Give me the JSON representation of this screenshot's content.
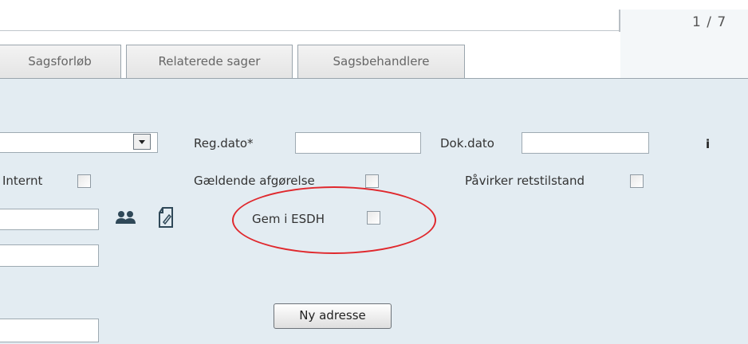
{
  "header": {
    "pager": "1 / 7"
  },
  "tabs": [
    {
      "label": "Sagsforløb"
    },
    {
      "label": "Relaterede sager"
    },
    {
      "label": "Sagsbehandlere"
    }
  ],
  "form": {
    "reg_dato_label": "Reg.dato*",
    "reg_dato_value": "",
    "dok_dato_label": "Dok.dato",
    "dok_dato_value": "",
    "info_glyph": "i",
    "internt_label": "Internt",
    "gaeldende_label": "Gældende afgørelse",
    "paavirker_label": "Påvirker retstilstand",
    "gem_label": "Gem i ESDH",
    "ny_adresse_label": "Ny adresse"
  },
  "icons": [
    "users-icon",
    "document-icon",
    "dropdown-arrow-icon",
    "info-icon"
  ],
  "colors": {
    "panel": "#e3ecf2",
    "annotation": "#e0282d"
  }
}
